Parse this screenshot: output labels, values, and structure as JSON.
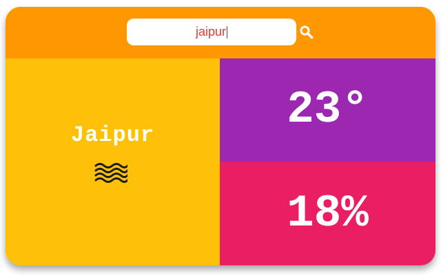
{
  "search": {
    "value": "jaipur",
    "icon": "search-icon"
  },
  "weather": {
    "city": "Jaipur",
    "condition_icon": "haze-icon",
    "temperature": "23°",
    "humidity": "18%"
  },
  "colors": {
    "header": "#ff9800",
    "city_panel": "#ffc107",
    "temperature_panel": "#9c27b0",
    "humidity_panel": "#e91e63",
    "search_text": "#e53935"
  }
}
